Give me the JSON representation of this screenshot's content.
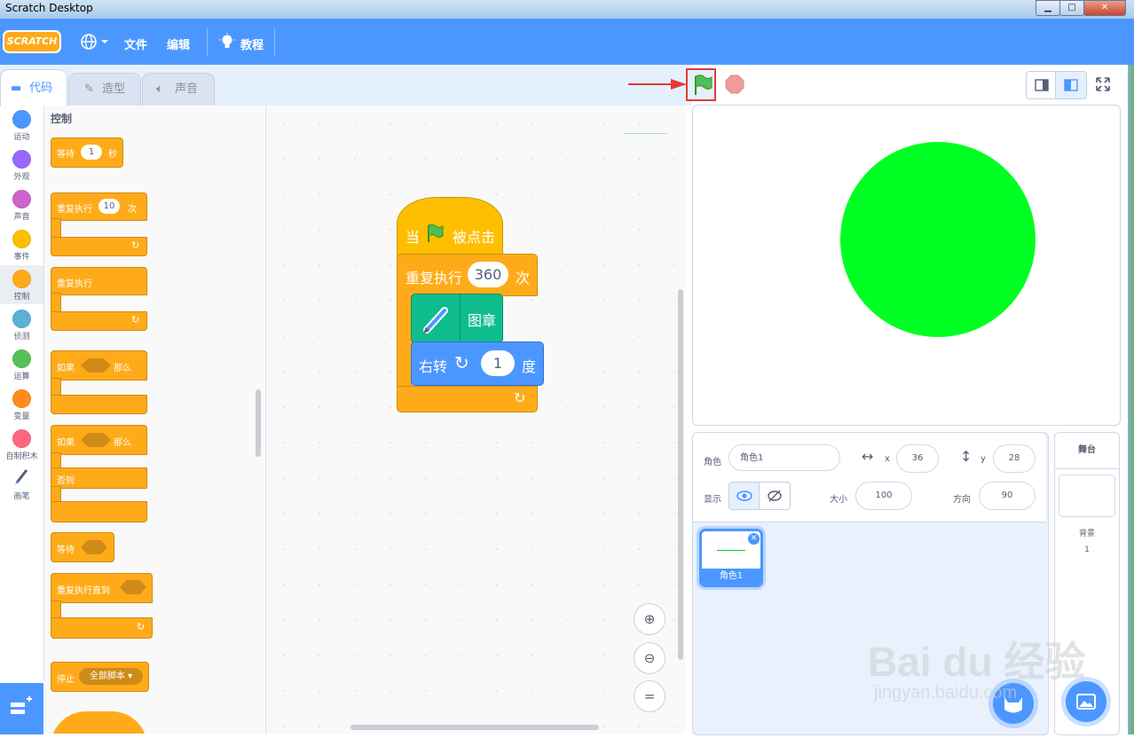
{
  "window": {
    "title": "Scratch Desktop",
    "controls": [
      "minimize",
      "maximize",
      "close"
    ]
  },
  "menubar": {
    "logo": "SCRATCH",
    "language_icon": "globe-icon",
    "file": "文件",
    "edit": "编辑",
    "tutorials": "教程"
  },
  "tabs": {
    "code": "代码",
    "costumes": "造型",
    "sounds": "声音"
  },
  "categories": [
    {
      "label": "运动",
      "color": "#4c97ff"
    },
    {
      "label": "外观",
      "color": "#9966ff"
    },
    {
      "label": "声音",
      "color": "#cf63cf"
    },
    {
      "label": "事件",
      "color": "#ffbf00"
    },
    {
      "label": "控制",
      "color": "#ffab19"
    },
    {
      "label": "侦测",
      "color": "#5cb1d6"
    },
    {
      "label": "运算",
      "color": "#59c059"
    },
    {
      "label": "变量",
      "color": "#ff8c1a"
    },
    {
      "label": "自制积木",
      "color": "#ff6680"
    },
    {
      "label": "画笔",
      "color": "pen-icon"
    }
  ],
  "palette": {
    "heading": "控制",
    "wait": {
      "label": "等待",
      "value": "1",
      "unit": "秒"
    },
    "repeat": {
      "label": "重复执行",
      "value": "10",
      "unit": "次"
    },
    "forever": {
      "label": "重复执行"
    },
    "if_then": {
      "label": "如果",
      "then": "那么"
    },
    "if_else": {
      "label": "如果",
      "then": "那么",
      "else": "否则"
    },
    "wait_until": {
      "label": "等待"
    },
    "repeat_until": {
      "label": "重复执行直到"
    },
    "stop": {
      "label": "停止",
      "option": "全部脚本"
    }
  },
  "script": {
    "hat": {
      "when": "当",
      "clicked": "被点击"
    },
    "repeat": {
      "label": "重复执行",
      "value": "360",
      "unit": "次"
    },
    "stamp": {
      "label": "图章"
    },
    "turn": {
      "label": "右转",
      "value": "1",
      "unit": "度"
    }
  },
  "stage": {
    "circle_color": "#00ff22"
  },
  "sprite_info": {
    "sprite_label": "角色",
    "sprite_name": "角色1",
    "x_label": "x",
    "x": "36",
    "y_label": "y",
    "y": "28",
    "show_label": "显示",
    "size_label": "大小",
    "size": "100",
    "direction_label": "方向",
    "direction": "90"
  },
  "sprites": [
    {
      "name": "角色1",
      "selected": true
    }
  ],
  "stage_panel": {
    "title": "舞台",
    "backdrops_label": "背景",
    "backdrops_count": "1"
  },
  "watermark": {
    "brand": "Bai du 经验",
    "url": "jingyan.baidu.com"
  },
  "colors": {
    "menu": "#4c97ff",
    "control": "#ffab19",
    "motion": "#4c97ff",
    "pen": "#0fbd8c",
    "annotation": "#e53935"
  }
}
